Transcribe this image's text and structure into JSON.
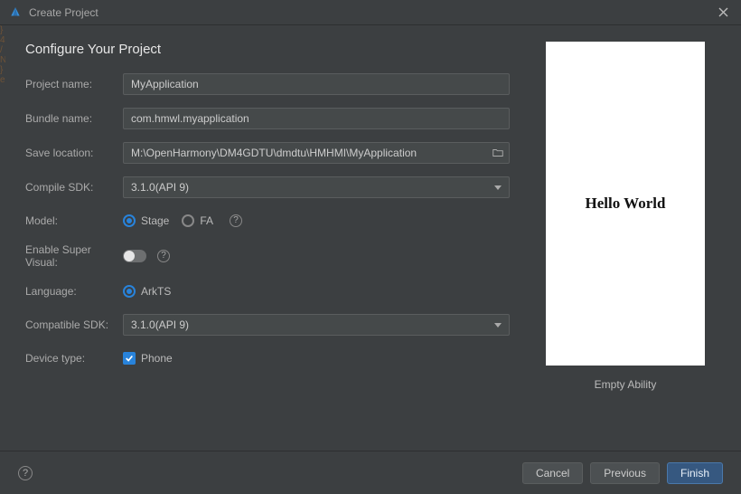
{
  "window": {
    "title": "Create Project"
  },
  "heading": "Configure Your Project",
  "labels": {
    "project_name": "Project name:",
    "bundle_name": "Bundle name:",
    "save_location": "Save location:",
    "compile_sdk": "Compile SDK:",
    "model": "Model:",
    "enable_super_visual": "Enable Super Visual:",
    "language": "Language:",
    "compatible_sdk": "Compatible SDK:",
    "device_type": "Device type:"
  },
  "fields": {
    "project_name": "MyApplication",
    "bundle_name": "com.hmwl.myapplication",
    "save_location": "M:\\OpenHarmony\\DM4GDTU\\dmdtu\\HMHMI\\MyApplication",
    "compile_sdk": "3.1.0(API 9)",
    "compatible_sdk": "3.1.0(API 9)"
  },
  "model": {
    "options": [
      "Stage",
      "FA"
    ],
    "selected": "Stage"
  },
  "language": {
    "options": [
      "ArkTS"
    ],
    "selected": "ArkTS"
  },
  "super_visual": {
    "enabled": false
  },
  "device_type": {
    "phone_label": "Phone",
    "phone_checked": true
  },
  "preview": {
    "text": "Hello World",
    "caption": "Empty Ability"
  },
  "buttons": {
    "cancel": "Cancel",
    "previous": "Previous",
    "finish": "Finish"
  }
}
